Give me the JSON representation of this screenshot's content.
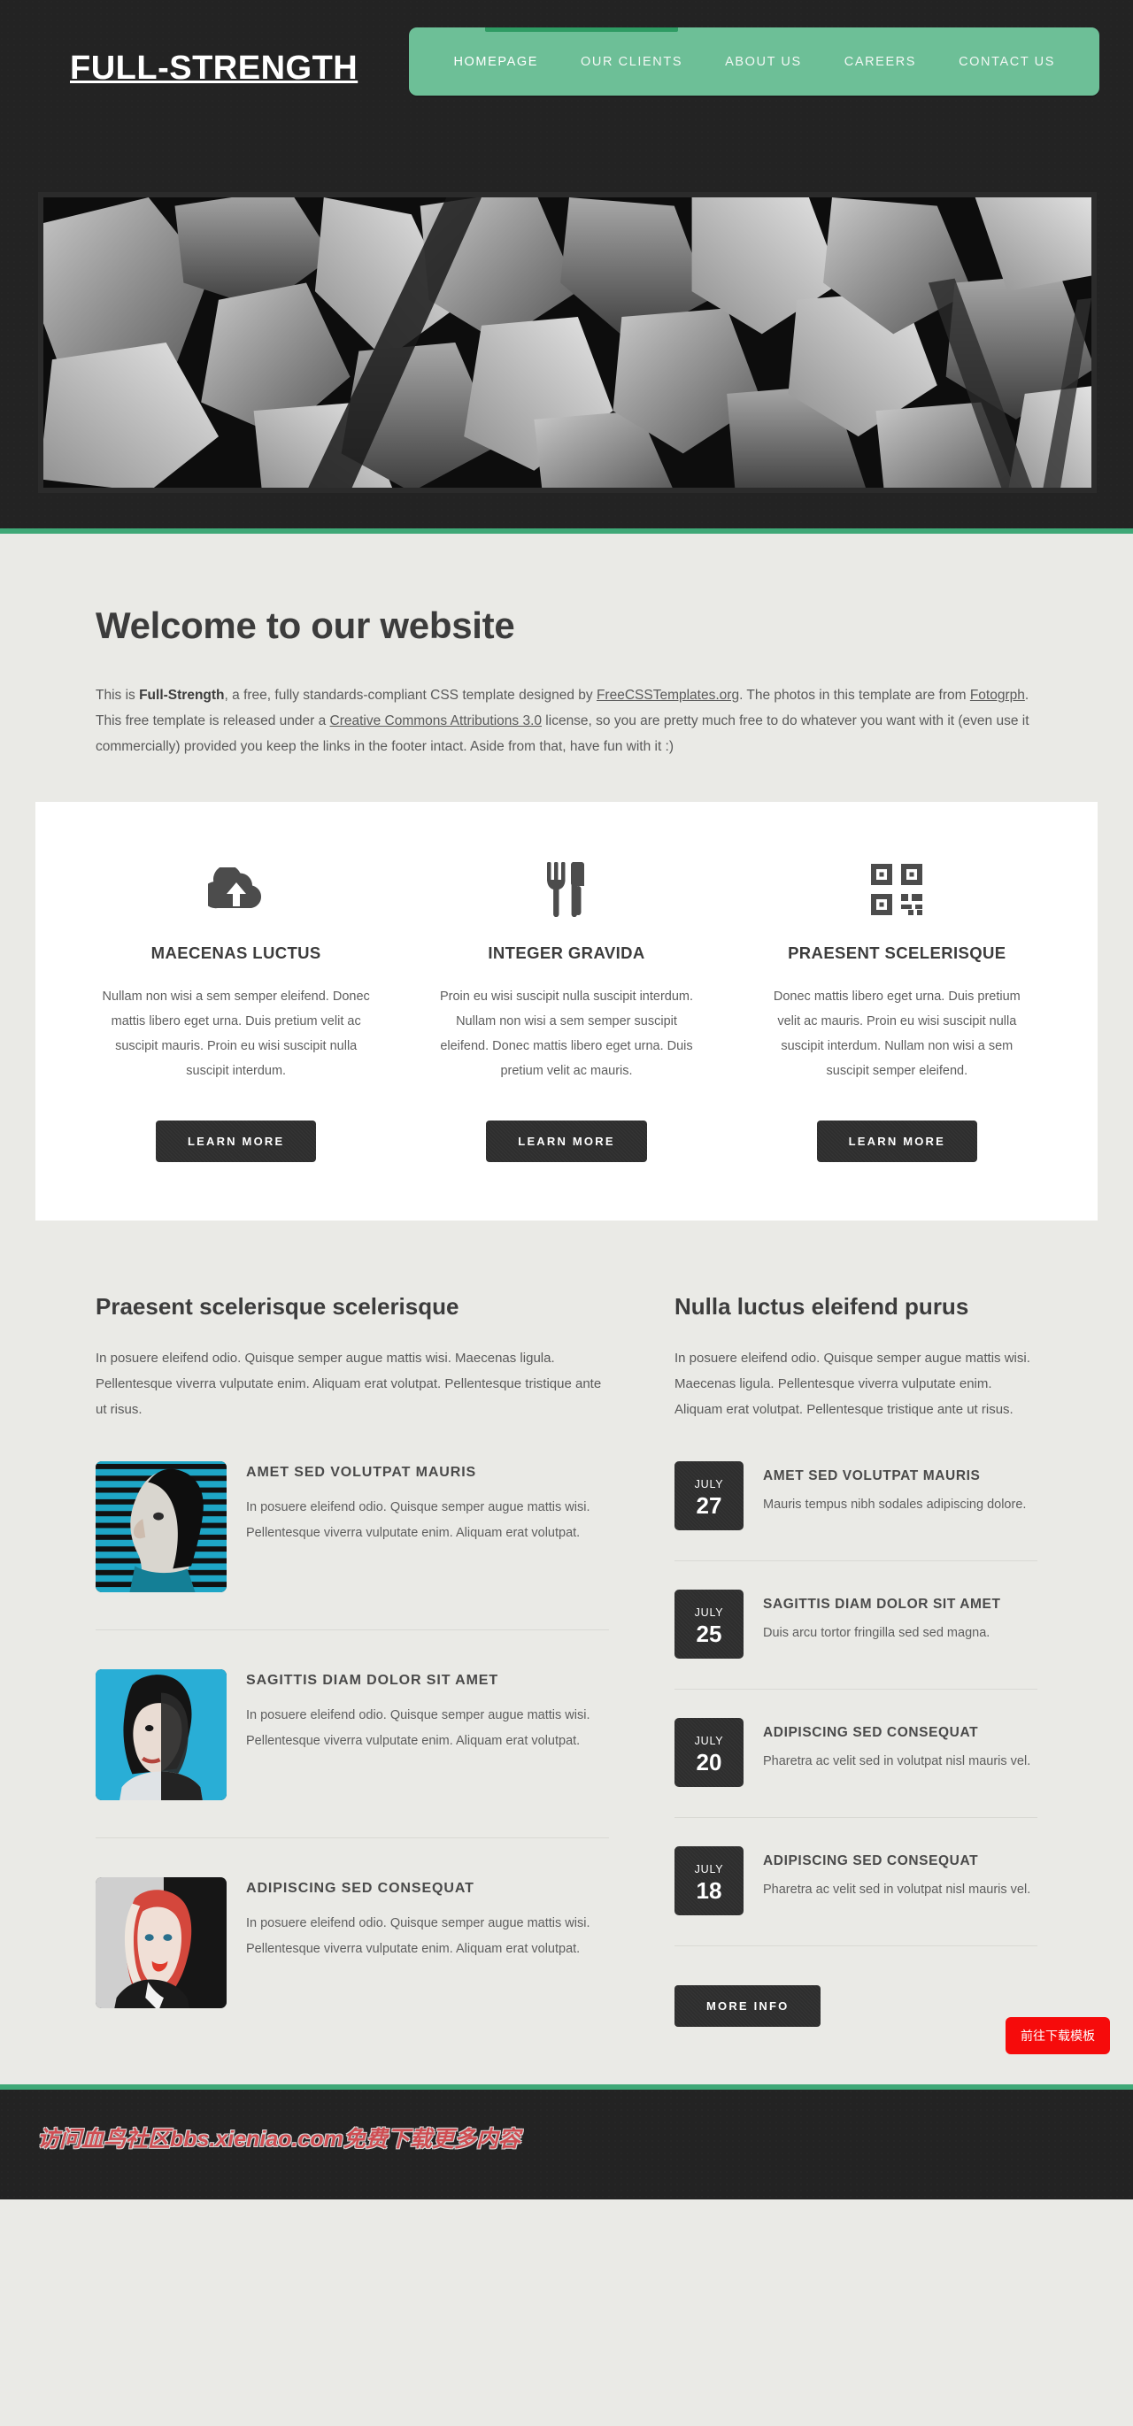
{
  "site": {
    "logo": "Full-Strength"
  },
  "nav": {
    "items": [
      {
        "label": "HOMEPAGE",
        "active": true
      },
      {
        "label": "OUR CLIENTS",
        "active": false
      },
      {
        "label": "ABOUT US",
        "active": false
      },
      {
        "label": "CAREERS",
        "active": false
      },
      {
        "label": "CONTACT US",
        "active": false
      }
    ]
  },
  "hero": {
    "alt": "grayscale photo of broken rocks and stone rubble"
  },
  "welcome": {
    "title": "Welcome to our website",
    "intro_part1": "This is ",
    "intro_bold": "Full-Strength",
    "intro_part2": ", a free, fully standards-compliant CSS template designed by ",
    "link1": "FreeCSSTemplates.org",
    "intro_part3": ". The photos in this template are from ",
    "link2": "Fotogrph",
    "intro_part4": ". This free template is released under a ",
    "link3": "Creative Commons Attributions 3.0",
    "intro_part5": " license, so you are pretty much free to do whatever you want with it (even use it commercially) provided you keep the links in the footer intact. Aside from that, have fun with it :)"
  },
  "features": [
    {
      "icon": "cloud-upload-icon",
      "title": "MAECENAS LUCTUS",
      "body": "Nullam non wisi a sem semper eleifend. Donec mattis libero eget urna. Duis pretium velit ac suscipit mauris. Proin eu wisi suscipit nulla suscipit interdum.",
      "button": "LEARN MORE"
    },
    {
      "icon": "fork-knife-icon",
      "title": "INTEGER GRAVIDA",
      "body": "Proin eu wisi suscipit nulla suscipit interdum. Nullam non wisi a sem semper suscipit eleifend. Donec mattis libero eget urna. Duis pretium velit ac mauris.",
      "button": "LEARN MORE"
    },
    {
      "icon": "qr-code-icon",
      "title": "PRAESENT SCELERISQUE",
      "body": "Donec mattis libero eget urna. Duis pretium velit ac mauris. Proin eu wisi suscipit nulla suscipit interdum. Nullam non wisi a sem suscipit semper eleifend.",
      "button": "LEARN MORE"
    }
  ],
  "left_column": {
    "title": "Praesent scelerisque scelerisque",
    "intro": "In posuere eleifend odio. Quisque semper augue mattis wisi. Maecenas ligula. Pellentesque viverra vulputate enim. Aliquam erat volutpat. Pellentesque tristique ante ut risus.",
    "items": [
      {
        "thumb": "portrait-man-blinds",
        "title": "AMET SED VOLUTPAT MAURIS",
        "body": "In posuere eleifend odio. Quisque semper augue mattis wisi. Pellentesque viverra vulputate enim. Aliquam erat volutpat."
      },
      {
        "thumb": "portrait-woman-blue",
        "title": "SAGITTIS DIAM DOLOR SIT AMET",
        "body": "In posuere eleifend odio. Quisque semper augue mattis wisi. Pellentesque viverra vulputate enim. Aliquam erat volutpat."
      },
      {
        "thumb": "portrait-woman-blonde",
        "title": "ADIPISCING SED CONSEQUAT",
        "body": "In posuere eleifend odio. Quisque semper augue mattis wisi. Pellentesque viverra vulputate enim. Aliquam erat volutpat."
      }
    ]
  },
  "right_column": {
    "title": "Nulla luctus eleifend purus",
    "intro": "In posuere eleifend odio. Quisque semper augue mattis wisi. Maecenas ligula. Pellentesque viverra vulputate enim. Aliquam erat volutpat. Pellentesque tristique ante ut risus.",
    "items": [
      {
        "month": "JULY",
        "day": "27",
        "title": "AMET SED VOLUTPAT MAURIS",
        "body": "Mauris tempus nibh sodales adipiscing dolore."
      },
      {
        "month": "JULY",
        "day": "25",
        "title": "SAGITTIS DIAM DOLOR SIT AMET",
        "body": "Duis arcu tortor fringilla sed sed magna."
      },
      {
        "month": "JULY",
        "day": "20",
        "title": "ADIPISCING SED CONSEQUAT",
        "body": "Pharetra ac velit sed in volutpat nisl mauris vel."
      },
      {
        "month": "JULY",
        "day": "18",
        "title": "ADIPISCING SED CONSEQUAT",
        "body": "Pharetra ac velit sed in volutpat nisl mauris vel."
      }
    ],
    "more_button": "MORE INFO"
  },
  "footer": {
    "watermark": "访问血鸟社区bbs.xieniao.com免费下载更多内容",
    "download_button": "前往下载模板"
  },
  "colors": {
    "accent_green": "#6dbf97",
    "accent_green_dark": "#3fa877",
    "dark": "#232323",
    "page_bg": "#eaeae6",
    "card_bg": "#ffffff",
    "watermark_red": "#cf4d52",
    "download_red": "#f60b0b"
  }
}
